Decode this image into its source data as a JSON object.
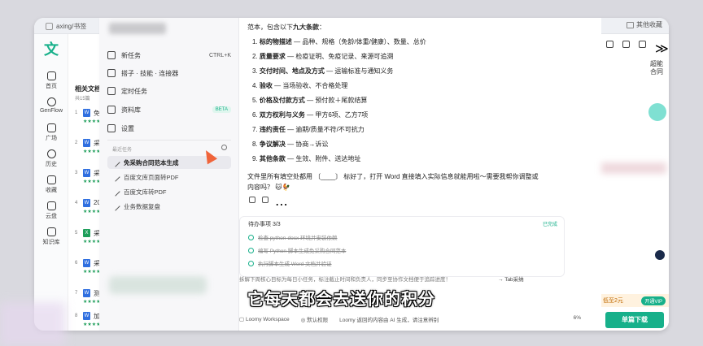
{
  "browser": {
    "tab_title": "axing/书签",
    "right_bookmark": "其他收藏"
  },
  "rail": {
    "logo": "文",
    "items": [
      "首页",
      "GenFlow",
      "广场",
      "历史",
      "收藏",
      "云盘",
      "知识库"
    ]
  },
  "doclist": {
    "title": "相关文档推",
    "count": "共15篇",
    "rows": [
      {
        "num": "1",
        "type": "W",
        "text": "免"
      },
      {
        "num": "2",
        "type": "W",
        "text": "采"
      },
      {
        "num": "3",
        "type": "W",
        "text": "采"
      },
      {
        "num": "4",
        "type": "W",
        "text": "202"
      },
      {
        "num": "5",
        "type": "X",
        "text": "采"
      },
      {
        "num": "6",
        "type": "W",
        "text": "采"
      },
      {
        "num": "7",
        "type": "W",
        "text": "测"
      },
      {
        "num": "8",
        "type": "W",
        "text": "加"
      }
    ]
  },
  "panel": {
    "new_task": "新任务",
    "new_task_shortcut": "CTRL+K",
    "skills": "搭子 · 技能 · 连接器",
    "scheduled": "定时任务",
    "library": "资料库",
    "library_badge": "BETA",
    "settings": "设置",
    "recent_title": "最近任务",
    "recent": [
      "免采购合同范本生成",
      "百度文库页面转PDF",
      "百度文库转PDF",
      "业务数据复盘"
    ]
  },
  "chat": {
    "intro_prefix": "范本，包含以下",
    "intro_bold": "九大条款",
    "intro_suffix": "：",
    "items": [
      {
        "n": "1.",
        "bold": "标的物描述",
        "rest": " — 品种、规格（免龄/体重/健康）、数量、总价"
      },
      {
        "n": "2.",
        "bold": "质量要求",
        "rest": " — 检疫证明、免疫记录、来源可追溯"
      },
      {
        "n": "3.",
        "bold": "交付时间、地点及方式",
        "rest": " — 运输标准与通知义务"
      },
      {
        "n": "4.",
        "bold": "验收",
        "rest": " — 当场验收、不合格处理"
      },
      {
        "n": "5.",
        "bold": "价格及付款方式",
        "rest": " — 预付款＋尾款结算"
      },
      {
        "n": "6.",
        "bold": "双方权利与义务",
        "rest": " — 甲方6项、乙方7项"
      },
      {
        "n": "7.",
        "bold": "违约责任",
        "rest": " — 逾期/质量不符/不可抗力"
      },
      {
        "n": "8.",
        "bold": "争议解决",
        "rest": " — 协商→诉讼"
      },
      {
        "n": "9.",
        "bold": "其他条款",
        "rest": " — 生效、附件、送达地址"
      }
    ],
    "outro1": "文件里所有填空处都用 〔____〕 标好了，打开 Word 直接填入实际信息就能用啦～需要我帮你调整或",
    "outro2": "内容吗？ 🐱🐓",
    "todo_title": "待办事项 3/3",
    "todo_status": "已完成",
    "todo_items": [
      "检查 python-docx 环境并安装依赖",
      "编写 Python 脚本生成免采购合同范本",
      "执行脚本生成 Word 文档并验证"
    ],
    "input_hint": "拆解下周核心目标为每日小任务，标注截止时间和负责人，同步至协作文档便于追踪进度！",
    "tab_adopt": "→ Tab采纳",
    "workspace": "Loomy Workspace",
    "permission": "默认权限",
    "disclaimer": "Loomy 返回的内容由 AI 生成，请注意辨别",
    "percent": "6%"
  },
  "subtitle": "它每天都会去送你的积分",
  "right": {
    "promo": "超能合同",
    "vip_text": "低至2元",
    "vip_btn": "开通VIP",
    "download": "单篇下载"
  }
}
